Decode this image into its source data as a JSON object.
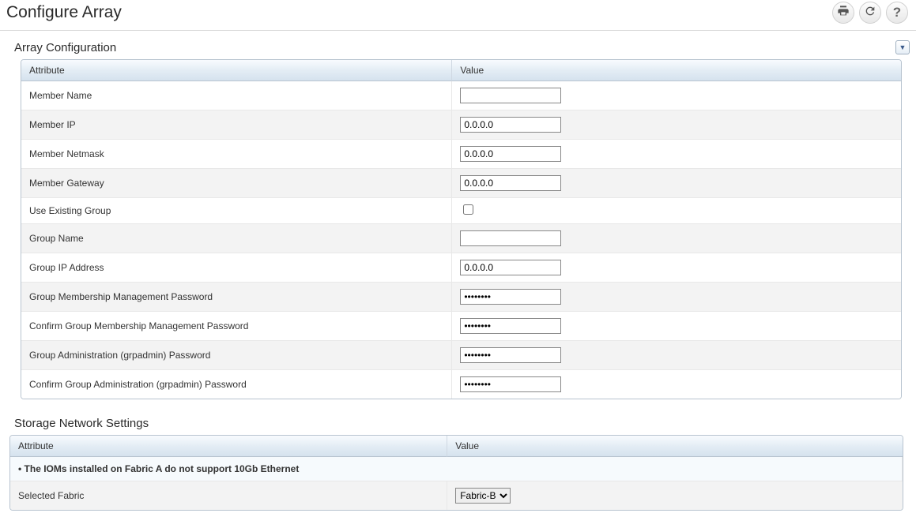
{
  "page_title": "Configure Array",
  "sections": {
    "array_config": {
      "title": "Array Configuration",
      "columns": {
        "attribute": "Attribute",
        "value": "Value"
      },
      "rows": [
        {
          "label": "Member Name",
          "type": "text",
          "value": ""
        },
        {
          "label": "Member IP",
          "type": "text",
          "value": "0.0.0.0"
        },
        {
          "label": "Member Netmask",
          "type": "text",
          "value": "0.0.0.0"
        },
        {
          "label": "Member Gateway",
          "type": "text",
          "value": "0.0.0.0"
        },
        {
          "label": "Use Existing Group",
          "type": "checkbox",
          "checked": false
        },
        {
          "label": "Group Name",
          "type": "text",
          "value": ""
        },
        {
          "label": "Group IP Address",
          "type": "text",
          "value": "0.0.0.0"
        },
        {
          "label": "Group Membership Management Password",
          "type": "password",
          "value": "••••••••"
        },
        {
          "label": "Confirm Group Membership Management Password",
          "type": "password",
          "value": "••••••••"
        },
        {
          "label": "Group Administration (grpadmin) Password",
          "type": "password",
          "value": "••••••••"
        },
        {
          "label": "Confirm Group Administration (grpadmin) Password",
          "type": "password",
          "value": "••••••••"
        }
      ]
    },
    "storage_network": {
      "title": "Storage Network Settings",
      "columns": {
        "attribute": "Attribute",
        "value": "Value"
      },
      "note": "• The IOMs installed on Fabric A do not support 10Gb Ethernet",
      "rows": [
        {
          "label": "Selected Fabric",
          "type": "select",
          "value": "Fabric-B",
          "options": [
            "Fabric-B"
          ]
        }
      ]
    }
  }
}
